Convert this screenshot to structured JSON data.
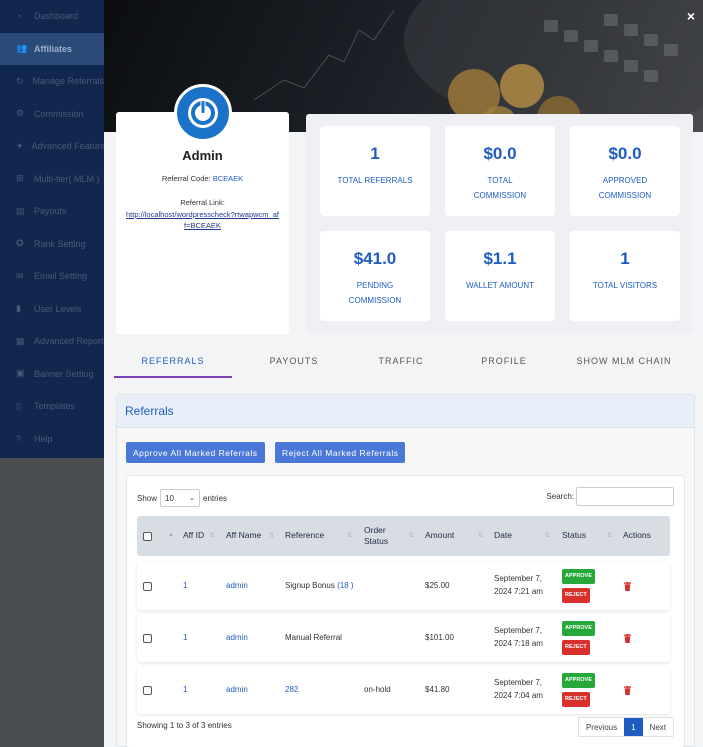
{
  "sidebar": {
    "items": [
      {
        "label": "Dashboard",
        "icon": "speedometer-icon",
        "active": false
      },
      {
        "label": "Affiliates",
        "icon": "users-icon",
        "active": true
      },
      {
        "label": "Manage Referrals",
        "icon": "refresh-icon",
        "active": false
      },
      {
        "label": "Commission",
        "icon": "gear-icon",
        "active": false
      },
      {
        "label": "Advanced Features",
        "icon": "star-icon",
        "active": false
      },
      {
        "label": "Multi-tier( MLM )",
        "icon": "sitemap-icon",
        "active": false
      },
      {
        "label": "Payouts",
        "icon": "wallet-icon",
        "active": false
      },
      {
        "label": "Rank Setting",
        "icon": "medal-icon",
        "active": false
      },
      {
        "label": "Email Setting",
        "icon": "envelope-icon",
        "active": false
      },
      {
        "label": "User Levels",
        "icon": "bar-chart-icon",
        "active": false
      },
      {
        "label": "Advanced Report",
        "icon": "report-icon",
        "active": false
      },
      {
        "label": "Banner Setting",
        "icon": "image-icon",
        "active": false
      },
      {
        "label": "Templates",
        "icon": "template-icon",
        "active": false
      },
      {
        "label": "Help",
        "icon": "help-icon",
        "active": false
      }
    ]
  },
  "modal": {
    "close_label": "×",
    "profile": {
      "name": "Admin",
      "referral_code_label": "Referral Code:",
      "referral_code": "BCEAEK",
      "referral_link_label": "Referral Link:",
      "referral_link": "http://localhost/wordpresscheck?rtwapwcm_aff=BCEAEK"
    },
    "stats": [
      {
        "value": "1",
        "label": "TOTAL REFERRALS"
      },
      {
        "value": "$0.0",
        "label": "TOTAL COMMISSION"
      },
      {
        "value": "$0.0",
        "label": "APPROVED COMMISSION"
      },
      {
        "value": "$41.0",
        "label": "PENDING COMMISSION"
      },
      {
        "value": "$1.1",
        "label": "WALLET AMOUNT"
      },
      {
        "value": "1",
        "label": "TOTAL VISITORS"
      }
    ],
    "tabs": [
      {
        "label": "REFERRALS",
        "active": true
      },
      {
        "label": "PAYOUTS",
        "active": false
      },
      {
        "label": "TRAFFIC",
        "active": false
      },
      {
        "label": "PROFILE",
        "active": false
      },
      {
        "label": "SHOW MLM CHAIN",
        "active": false
      }
    ],
    "referrals": {
      "title": "Referrals",
      "approve_all_label": "Approve All Marked Referrals",
      "reject_all_label": "Reject All Marked Referrals",
      "show_label": "Show",
      "entries_value": "10",
      "entries_label": "entries",
      "search_label": "Search:",
      "search_value": "",
      "columns": [
        "Aff ID",
        "Aff Name",
        "Reference",
        "Order Status",
        "Amount",
        "Date",
        "Status",
        "Actions"
      ],
      "rows": [
        {
          "aff_id": "1",
          "aff_name": "admin",
          "reference": "Signup Bonus",
          "reference_link": "(18 )",
          "order_status": "",
          "amount": "$25.00",
          "date": "September 7, 2024 7:21 am",
          "approve_label": "APPROVE",
          "reject_label": "REJECT"
        },
        {
          "aff_id": "1",
          "aff_name": "admin",
          "reference": "Manual Referral",
          "reference_link": "",
          "order_status": "",
          "amount": "$101.00",
          "date": "September 7, 2024 7:18 am",
          "approve_label": "APPROVE",
          "reject_label": "REJECT"
        },
        {
          "aff_id": "1",
          "aff_name": "admin",
          "reference": "",
          "reference_link": "282",
          "order_status": "on-hold",
          "amount": "$41.80",
          "date": "September 7, 2024 7:04 am",
          "approve_label": "APPROVE",
          "reject_label": "REJECT"
        }
      ],
      "info": "Showing 1 to 3 of 3 entries",
      "pager": {
        "previous": "Previous",
        "current": "1",
        "next": "Next"
      }
    }
  },
  "colors": {
    "accent": "#1f5cc2",
    "button": "#4a78d8",
    "approve": "#27a83a",
    "reject": "#d9302b",
    "tab_underline": "#7b3fb8",
    "sidebar": "#11284e"
  }
}
